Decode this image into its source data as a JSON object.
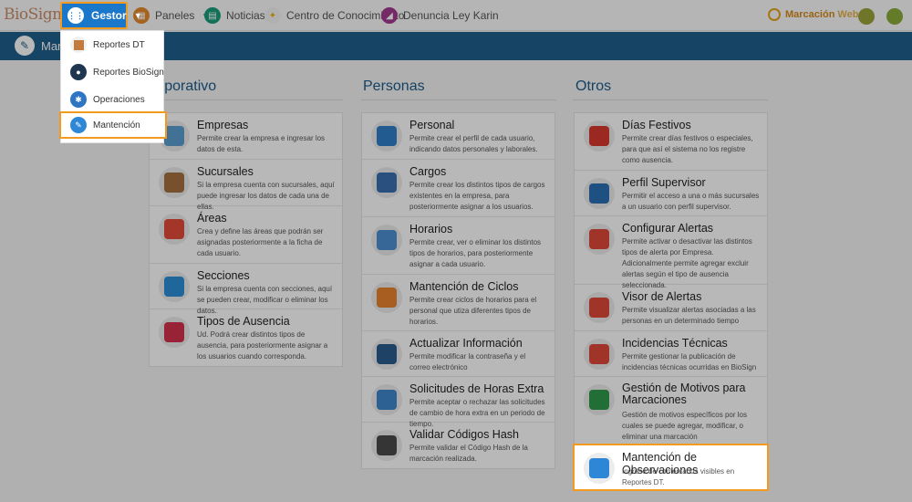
{
  "logo": "BioSign",
  "nav": {
    "gestor": "Gestor",
    "paneles": "Paneles",
    "noticias": "Noticias",
    "centro": "Centro de Conocimiento",
    "denuncia": "Denuncia Ley Karin",
    "marcacion": "Marcación",
    "marcacion_web": "Web"
  },
  "band": {
    "title": "Man"
  },
  "menu": [
    "Reportes DT",
    "Reportes BioSign",
    "Operaciones",
    "Mantención"
  ],
  "columns": {
    "corporativo": "orporativo",
    "personas": "Personas",
    "otros": "Otros"
  },
  "corporativo": [
    {
      "title": "Empresas",
      "desc": "Permite crear la empresa e ingresar los datos de esta."
    },
    {
      "title": "Sucursales",
      "desc": "Si la empresa cuenta con sucursales, aquí puede ingresar los datos de cada una de ellas."
    },
    {
      "title": "Áreas",
      "desc": "Crea y define las áreas que podrán ser asignadas posteriormente a la ficha de cada usuario."
    },
    {
      "title": "Secciones",
      "desc": "Si la empresa cuenta con secciones, aquí se pueden crear, modificar o eliminar los datos."
    },
    {
      "title": "Tipos de Ausencia",
      "desc": "Ud. Podrá crear distintos tipos de ausencia, para posteriormente asignar a los usuarios cuando corresponda."
    }
  ],
  "personas": [
    {
      "title": "Personal",
      "desc": "Permite crear el perfil de cada usuario, indicando datos personales y laborales."
    },
    {
      "title": "Cargos",
      "desc": "Permite crear los distintos tipos de cargos existentes en la empresa, para posteriormente asignar a los usuarios."
    },
    {
      "title": "Horarios",
      "desc": "Permite crear, ver o eliminar los distintos tipos de horarios, para posteriormente asignar a cada usuario."
    },
    {
      "title": "Mantención de Ciclos",
      "desc": "Permite crear ciclos de horarios para el personal que utiza diferentes tipos de horarios."
    },
    {
      "title": "Actualizar Información",
      "desc": "Permite modificar la contraseña y el correo electrónico"
    },
    {
      "title": "Solicitudes de Horas Extra",
      "desc": "Permite aceptar o rechazar las solicitudes de cambio de hora extra en un periodo de tiempo."
    },
    {
      "title": "Validar Códigos Hash",
      "desc": "Permite validar el Código Hash de la marcación realizada."
    }
  ],
  "otros": [
    {
      "title": "Días Festivos",
      "desc": "Permite crear días festivos o especiales, para que así el sistema no los registre como ausencia."
    },
    {
      "title": "Perfil Supervisor",
      "desc": "Permitir el acceso a una o más sucursales a un usuario con perfil supervisor."
    },
    {
      "title": "Configurar Alertas",
      "desc": "Permite activar o desactivar las distintos tipos de alerta por Empresa. Adicionalmente permite agregar excluir alertas según el tipo de ausencia seleccionada."
    },
    {
      "title": "Visor de Alertas",
      "desc": "Permite visualizar alertas asociadas a las personas en un determinado tiempo"
    },
    {
      "title": "Incidencias Técnicas",
      "desc": "Permite gestionar la publicación de incidencias técnicas ocurridas en BioSign"
    },
    {
      "title": "Gestión de Motivos para Marcaciones",
      "desc": "Gestión de motivos específicos por los cuales se puede agregar, modificar, o eliminar una marcación"
    }
  ],
  "focus_card": {
    "title": "Mantención de Observaciones",
    "desc": "Ingreso de comentarios visibles en Reportes DT."
  },
  "colors": {
    "accent": "#f29a1f",
    "primary": "#1a77c9",
    "band": "#1f5f8c"
  }
}
